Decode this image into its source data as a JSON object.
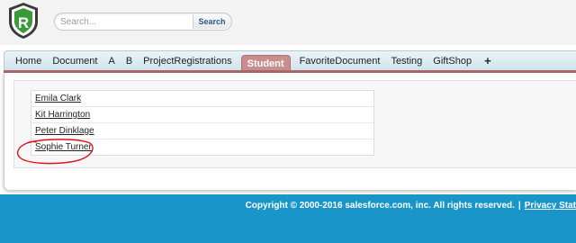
{
  "header": {
    "logo_letter": "R",
    "search": {
      "placeholder": "Search...",
      "button_label": "Search"
    }
  },
  "tabs": [
    {
      "label": "Home"
    },
    {
      "label": "Document"
    },
    {
      "label": "A"
    },
    {
      "label": "B"
    },
    {
      "label": "ProjectRegistrations"
    },
    {
      "label": "Student",
      "active": true
    },
    {
      "label": "FavoriteDocument"
    },
    {
      "label": "Testing"
    },
    {
      "label": "GiftShop"
    },
    {
      "label": "+"
    }
  ],
  "students": [
    "Emila Clark",
    "Kit Harrington",
    "Peter Dinklage",
    "Sophie Turner"
  ],
  "footer": {
    "copyright": "Copyright © 2000-2016 salesforce.com, inc. All rights reserved.",
    "separator": "|",
    "privacy_label": "Privacy Stat"
  },
  "colors": {
    "active_tab": "#c98d8d",
    "tab_underline": "#a86868",
    "footer_bg": "#1a95c9",
    "annotation": "#e0141e",
    "logo_green": "#3a9a3a"
  }
}
